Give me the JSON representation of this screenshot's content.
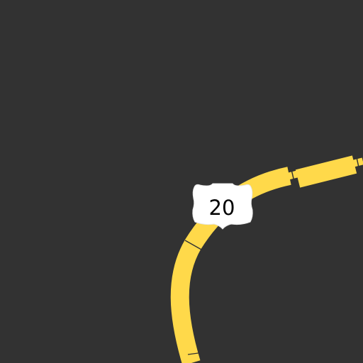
{
  "map": {
    "background_color": "#323232",
    "highway": {
      "color": "#ffd94a",
      "route_shield": {
        "type": "us-route-shield",
        "number": "20",
        "shield_color": "#ffffff",
        "text_color": "#000000"
      }
    }
  }
}
